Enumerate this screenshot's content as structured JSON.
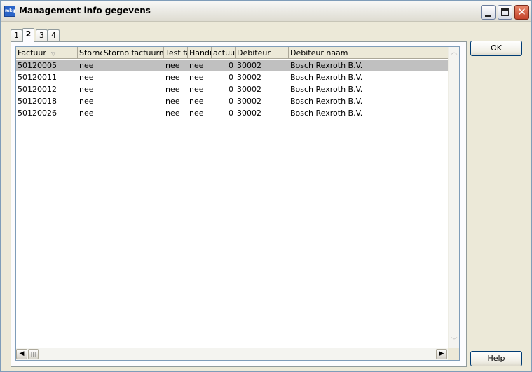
{
  "window": {
    "title": "Management info gegevens",
    "app_icon_text": "mkg"
  },
  "tabs": [
    {
      "label": "1",
      "active": false
    },
    {
      "label": "2",
      "active": true
    },
    {
      "label": "3",
      "active": false
    },
    {
      "label": "4",
      "active": false
    }
  ],
  "grid": {
    "columns": [
      "Factuur",
      "Stornc",
      "Storno factuurnun",
      "Test fa",
      "Handn",
      "actuur",
      "Debiteur",
      "Debiteur naam"
    ],
    "rows": [
      {
        "factuur": "50120005",
        "storno": "nee",
        "storno_factuurnummer": "",
        "test": "nee",
        "handm": "nee",
        "actuur": "0",
        "debiteur": "30002",
        "debiteur_naam": "Bosch Rexroth B.V.",
        "selected": true
      },
      {
        "factuur": "50120011",
        "storno": "nee",
        "storno_factuurnummer": "",
        "test": "nee",
        "handm": "nee",
        "actuur": "0",
        "debiteur": "30002",
        "debiteur_naam": "Bosch Rexroth B.V.",
        "selected": false
      },
      {
        "factuur": "50120012",
        "storno": "nee",
        "storno_factuurnummer": "",
        "test": "nee",
        "handm": "nee",
        "actuur": "0",
        "debiteur": "30002",
        "debiteur_naam": "Bosch Rexroth B.V.",
        "selected": false
      },
      {
        "factuur": "50120018",
        "storno": "nee",
        "storno_factuurnummer": "",
        "test": "nee",
        "handm": "nee",
        "actuur": "0",
        "debiteur": "30002",
        "debiteur_naam": "Bosch Rexroth B.V.",
        "selected": false
      },
      {
        "factuur": "50120026",
        "storno": "nee",
        "storno_factuurnummer": "",
        "test": "nee",
        "handm": "nee",
        "actuur": "0",
        "debiteur": "30002",
        "debiteur_naam": "Bosch Rexroth B.V.",
        "selected": false
      }
    ]
  },
  "buttons": {
    "ok": "OK",
    "help": "Help"
  },
  "colors": {
    "selected_row": "#c0c0c0",
    "window_bg": "#ece9d8",
    "button_border": "#003c74"
  }
}
